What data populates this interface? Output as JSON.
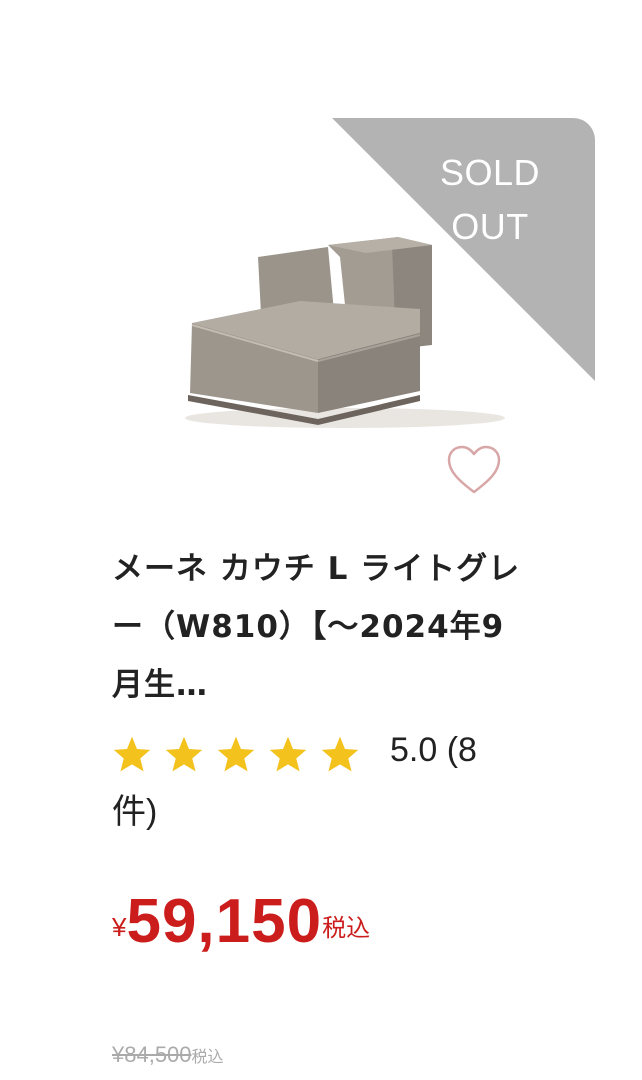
{
  "product": {
    "badge_line1": "SOLD",
    "badge_line2": "OUT",
    "title": "メーネ カウチ L ライトグレー（W810）【～2024年9月生…",
    "rating": {
      "stars": 5,
      "score": "5.0",
      "count": "(8件)"
    },
    "price": {
      "currency": "¥",
      "amount": "59,150",
      "tax_label": "税込"
    },
    "original_price": {
      "amount": "¥84,500",
      "tax_label": "税込"
    }
  },
  "icons": {
    "favorite": "heart-outline-icon",
    "star": "star-icon"
  },
  "colors": {
    "price": "#cc1d1d",
    "star": "#f4c21c",
    "heart": "#d8a6a6",
    "badge": "#b3b3b3",
    "old_price": "#aaaaaa"
  }
}
